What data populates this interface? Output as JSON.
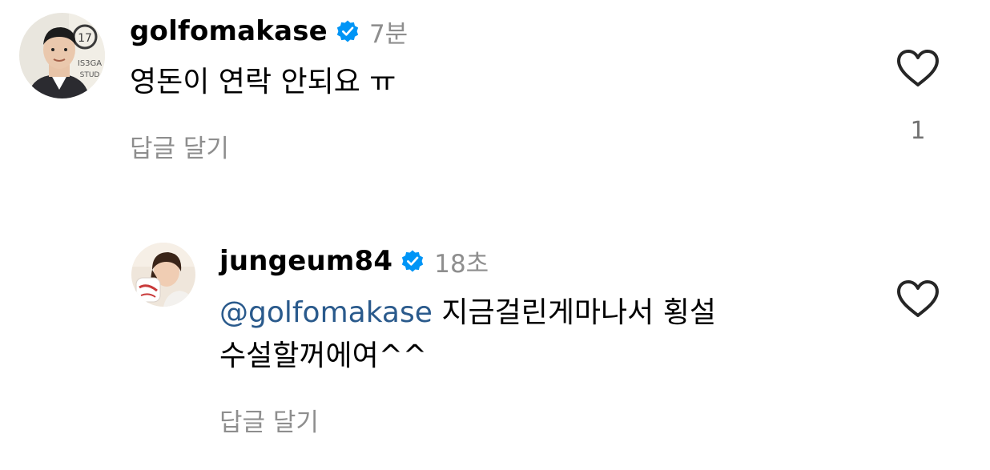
{
  "comments": [
    {
      "username": "golfomakase",
      "verified": true,
      "time": "7분",
      "text": "영돈이 연락 안되요 ㅠ",
      "reply_label": "답글 달기",
      "like_count": "1",
      "avatar_icon": "profile-photo-man-suit"
    },
    {
      "username": "jungeum84",
      "verified": true,
      "time": "18초",
      "mention": "@golfomakase",
      "text_line1": " 지금걸린게마나서 횡설",
      "text_line2": "수설할꺼에여^^",
      "reply_label": "답글 달기",
      "avatar_icon": "profile-photo-woman"
    }
  ],
  "colors": {
    "username": "#000000",
    "secondary": "#8e8e8e",
    "mention": "#2a5a8c",
    "verified_badge": "#0095f6"
  }
}
